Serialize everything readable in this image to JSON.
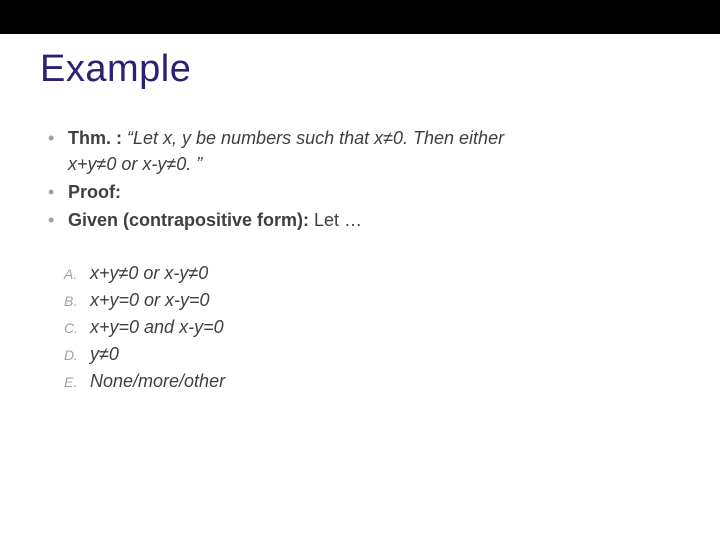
{
  "title": "Example",
  "thm_label": "Thm. :",
  "thm_text_1": " “Let x, y be numbers such that x≠0. Then either",
  "thm_text_2": "x+y≠0 or x-y≠0. ”",
  "proof_label": "Proof:",
  "given_label": "Given (contrapositive form):",
  "given_rest": " Let …",
  "options": [
    {
      "letter": "A.",
      "text": "x+y≠0 or x-y≠0"
    },
    {
      "letter": "B.",
      "text": "x+y=0 or x-y=0"
    },
    {
      "letter": "C.",
      "text": "x+y=0 and x-y=0"
    },
    {
      "letter": "D.",
      "text": "y≠0"
    },
    {
      "letter": "E.",
      "text": "None/more/other"
    }
  ]
}
